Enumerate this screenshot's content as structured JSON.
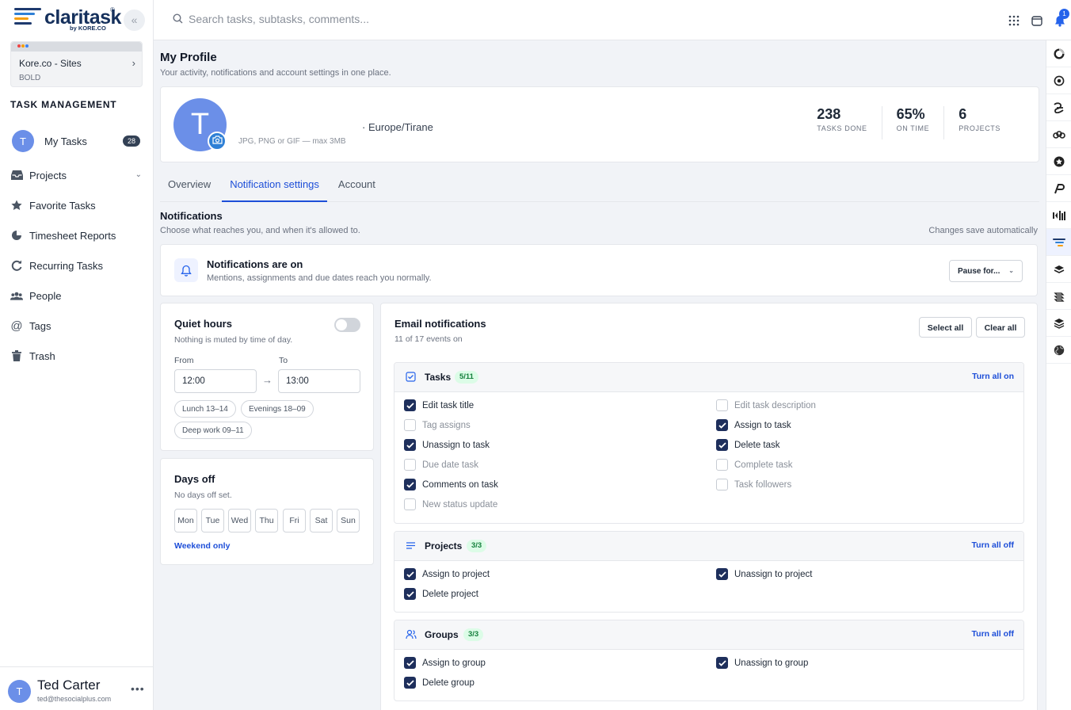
{
  "brand": {
    "word": "claritask",
    "by": "by KORE.CO",
    "reg": "®",
    "colors": [
      "#1e3a6e",
      "#2f80d6",
      "#f59e0b"
    ]
  },
  "workspace": {
    "name": "Kore.co - Sites",
    "sub": "BOLD"
  },
  "sidebar": {
    "section": "TASK MANAGEMENT",
    "my_tasks": {
      "avatar": "T",
      "label": "My Tasks",
      "count": "28"
    },
    "items": [
      {
        "label": "Projects",
        "icon": "inbox-icon"
      },
      {
        "label": "Favorite Tasks",
        "icon": "star-icon"
      },
      {
        "label": "Timesheet Reports",
        "icon": "pie-chart-icon"
      },
      {
        "label": "Recurring Tasks",
        "icon": "refresh-icon"
      },
      {
        "label": "People",
        "icon": "people-icon"
      },
      {
        "label": "Tags",
        "icon": "at-icon"
      },
      {
        "label": "Trash",
        "icon": "trash-icon"
      }
    ]
  },
  "user": {
    "avatar": "T",
    "name": "Ted Carter",
    "email": "ted@thesocialplus.com"
  },
  "search": {
    "placeholder": "Search tasks, subtasks, comments..."
  },
  "topbar": {
    "notif_count": "1"
  },
  "profile": {
    "title": "My Profile",
    "subtitle": "Your activity, notifications and account settings in one place.",
    "avatar": "T",
    "hint": "JPG, PNG or GIF — max 3MB",
    "timezone": "· Europe/Tirane",
    "stats": [
      {
        "value": "238",
        "label": "TASKS DONE"
      },
      {
        "value": "65%",
        "label": "ON TIME"
      },
      {
        "value": "6",
        "label": "PROJECTS"
      }
    ]
  },
  "tabs": [
    {
      "label": "Overview",
      "active": false
    },
    {
      "label": "Notification settings",
      "active": true
    },
    {
      "label": "Account",
      "active": false
    }
  ],
  "notifications": {
    "title": "Notifications",
    "subtitle": "Choose what reaches you, and when it's allowed to.",
    "autosave": "Changes save automatically",
    "status_title": "Notifications are on",
    "status_sub": "Mentions, assignments and due dates reach you normally.",
    "pause_label": "Pause for..."
  },
  "quiet": {
    "title": "Quiet hours",
    "subtitle": "Nothing is muted by time of day.",
    "enabled": false,
    "from_label": "From",
    "to_label": "To",
    "from": "12:00",
    "to": "13:00",
    "arrow": "→",
    "chips": [
      "Lunch 13–14",
      "Evenings 18–09",
      "Deep work 09–11"
    ]
  },
  "days_off": {
    "title": "Days off",
    "subtitle": "No days off set.",
    "days": [
      "Mon",
      "Tue",
      "Wed",
      "Thu",
      "Fri",
      "Sat",
      "Sun"
    ],
    "weekend": "Weekend only"
  },
  "email": {
    "title": "Email notifications",
    "subtitle": "11 of 17 events on",
    "select_all": "Select all",
    "clear_all": "Clear all",
    "groups": [
      {
        "title": "Tasks",
        "count": "5/11",
        "action": "Turn all on",
        "options": [
          {
            "label": "Edit task title",
            "on": true
          },
          {
            "label": "Edit task description",
            "on": false
          },
          {
            "label": "Tag assigns",
            "on": false
          },
          {
            "label": "Assign to task",
            "on": true
          },
          {
            "label": "Unassign to task",
            "on": true
          },
          {
            "label": "Delete task",
            "on": true
          },
          {
            "label": "Due date task",
            "on": false
          },
          {
            "label": "Complete task",
            "on": false
          },
          {
            "label": "Comments on task",
            "on": true
          },
          {
            "label": "Task followers",
            "on": false
          },
          {
            "label": "New status update",
            "on": false
          }
        ]
      },
      {
        "title": "Projects",
        "count": "3/3",
        "action": "Turn all off",
        "options": [
          {
            "label": "Assign to project",
            "on": true
          },
          {
            "label": "Unassign to project",
            "on": true
          },
          {
            "label": "Delete project",
            "on": true
          }
        ]
      },
      {
        "title": "Groups",
        "count": "3/3",
        "action": "Turn all off",
        "options": [
          {
            "label": "Assign to group",
            "on": true
          },
          {
            "label": "Unassign to group",
            "on": true
          },
          {
            "label": "Delete group",
            "on": true
          }
        ]
      }
    ]
  }
}
